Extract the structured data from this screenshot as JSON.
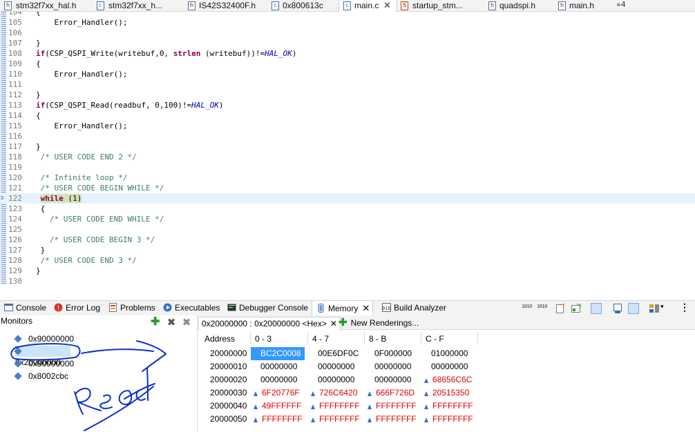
{
  "editor_tabs": [
    {
      "label": "stm32f7xx_hal.h",
      "icon": "h-file-icon"
    },
    {
      "label": "stm32f7xx_h...",
      "icon": "c-file-icon"
    },
    {
      "label": "IS42S32400F.h",
      "icon": "h-file-icon"
    },
    {
      "label": "0x800613c",
      "icon": "c-file-icon"
    },
    {
      "label": "main.c",
      "icon": "c-file-icon",
      "active": true
    },
    {
      "label": "startup_stm...",
      "icon": "s-file-icon"
    },
    {
      "label": "quadspi.h",
      "icon": "h-file-icon"
    },
    {
      "label": "main.h",
      "icon": "h-file-icon"
    }
  ],
  "editor_more": "»4",
  "code_lines": [
    {
      "n": "104",
      "t": "{"
    },
    {
      "n": "105",
      "t": "    Error_Handler();"
    },
    {
      "n": "106",
      "t": ""
    },
    {
      "n": "107",
      "t": "}"
    },
    {
      "n": "108",
      "t": "if(CSP_QSPI_Write(writebuf,0, strlen (writebuf))!=HAL_OK)"
    },
    {
      "n": "109",
      "t": "{"
    },
    {
      "n": "110",
      "t": "    Error_Handler();"
    },
    {
      "n": "111",
      "t": ""
    },
    {
      "n": "112",
      "t": "}"
    },
    {
      "n": "113",
      "t": "if(CSP_QSPI_Read(readbuf, 0,100)!=HAL_OK)"
    },
    {
      "n": "114",
      "t": "{"
    },
    {
      "n": "115",
      "t": "    Error_Handler();"
    },
    {
      "n": "116",
      "t": ""
    },
    {
      "n": "117",
      "t": "}"
    },
    {
      "n": "118",
      "t": " /* USER CODE END 2 */"
    },
    {
      "n": "119",
      "t": ""
    },
    {
      "n": "120",
      "t": " /* Infinite loop */"
    },
    {
      "n": "121",
      "t": " /* USER CODE BEGIN WHILE */"
    },
    {
      "n": "122",
      "t": " while (1)"
    },
    {
      "n": "123",
      "t": " {"
    },
    {
      "n": "124",
      "t": "   /* USER CODE END WHILE */"
    },
    {
      "n": "125",
      "t": ""
    },
    {
      "n": "126",
      "t": "   /* USER CODE BEGIN 3 */"
    },
    {
      "n": "127",
      "t": " }"
    },
    {
      "n": "128",
      "t": " /* USER CODE END 3 */"
    },
    {
      "n": "129",
      "t": "}"
    },
    {
      "n": "130",
      "t": ""
    }
  ],
  "code_tokens": {
    "if_kw": "if",
    "write_call": "(CSP_QSPI_Write(writebuf,0, ",
    "strlen": "strlen",
    "write_tail": " (writebuf))!=",
    "hal_ok": "HAL_OK",
    "close_paren": ")",
    "read_call": "(CSP_QSPI_Read(readbuf, 0,100)!=",
    "while_kw": "while",
    "while_cond": " (1)"
  },
  "view_tabs": [
    {
      "label": "Console",
      "icon": "console-icon"
    },
    {
      "label": "Error Log",
      "icon": "error-log-icon"
    },
    {
      "label": "Problems",
      "icon": "problems-icon"
    },
    {
      "label": "Executables",
      "icon": "executables-icon"
    },
    {
      "label": "Debugger Console",
      "icon": "debugger-console-icon"
    },
    {
      "label": "Memory",
      "icon": "memory-icon",
      "active": true
    },
    {
      "label": "Build Analyzer",
      "icon": "build-analyzer-icon"
    }
  ],
  "toolbar_labels": {
    "b1": "1010",
    "b2": "1010"
  },
  "monitors": {
    "title": "Monitors",
    "items": [
      "0x90000000",
      "0x20000000",
      "0x80000000",
      "0x8002cbc"
    ],
    "selected_index": 1
  },
  "renderings": {
    "active_tab": "0x20000000 : 0x20000000 <Hex>",
    "new_tab": "New Renderings...",
    "headers": [
      "Address",
      "0 - 3",
      "4 - 7",
      "8 - B",
      "C - F"
    ],
    "rows": [
      {
        "addr": "20000000",
        "cells": [
          {
            "v": "BC2C0008",
            "sel": true
          },
          {
            "v": "00E6DF0C"
          },
          {
            "v": "0F000000"
          },
          {
            "v": "01000000"
          }
        ]
      },
      {
        "addr": "20000010",
        "cells": [
          {
            "v": "00000000"
          },
          {
            "v": "00000000"
          },
          {
            "v": "00000000"
          },
          {
            "v": "00000000"
          }
        ]
      },
      {
        "addr": "20000020",
        "cells": [
          {
            "v": "00000000"
          },
          {
            "v": "00000000"
          },
          {
            "v": "00000000"
          },
          {
            "v": "68656C6C",
            "chg": true
          }
        ]
      },
      {
        "addr": "20000030",
        "cells": [
          {
            "v": "6F20776F",
            "chg": true
          },
          {
            "v": "726C6420",
            "chg": true
          },
          {
            "v": "666F726D",
            "chg": true
          },
          {
            "v": "20515350",
            "chg": true
          }
        ]
      },
      {
        "addr": "20000040",
        "cells": [
          {
            "v": "49FFFFFF",
            "chg": true
          },
          {
            "v": "FFFFFFFF",
            "chg": true
          },
          {
            "v": "FFFFFFFF",
            "chg": true
          },
          {
            "v": "FFFFFFFF",
            "chg": true
          }
        ]
      },
      {
        "addr": "20000050",
        "cells": [
          {
            "v": "FFFFFFFF",
            "chg": true
          },
          {
            "v": "FFFFFFFF",
            "chg": true
          },
          {
            "v": "FFFFFFFF",
            "chg": true
          },
          {
            "v": "FFFFFFFF",
            "chg": true
          }
        ]
      }
    ]
  },
  "colors": {
    "changed_value": "#e00000",
    "selection": "#3399ff",
    "annotation_ink": "#0a2fc8"
  }
}
